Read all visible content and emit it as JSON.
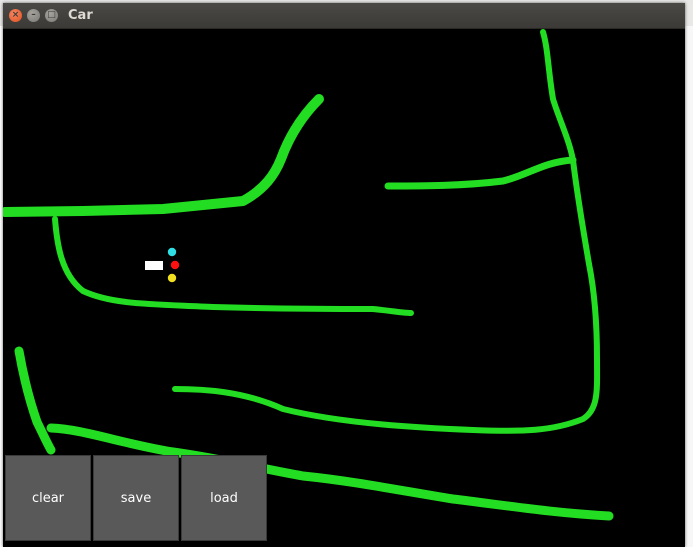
{
  "window": {
    "title": "Car"
  },
  "buttons": {
    "clear": "clear",
    "save": "save",
    "load": "load"
  },
  "colors": {
    "track": "#22dd22",
    "canvas_bg": "#000000",
    "car_body": "#ffffff",
    "sensor_top": "#2ee0e6",
    "sensor_middle": "#ff1010",
    "sensor_bottom": "#f0e020",
    "button_bg": "#595959"
  },
  "icons": {
    "close": "close-icon",
    "minimize": "minimize-icon",
    "maximize": "maximize-icon"
  }
}
